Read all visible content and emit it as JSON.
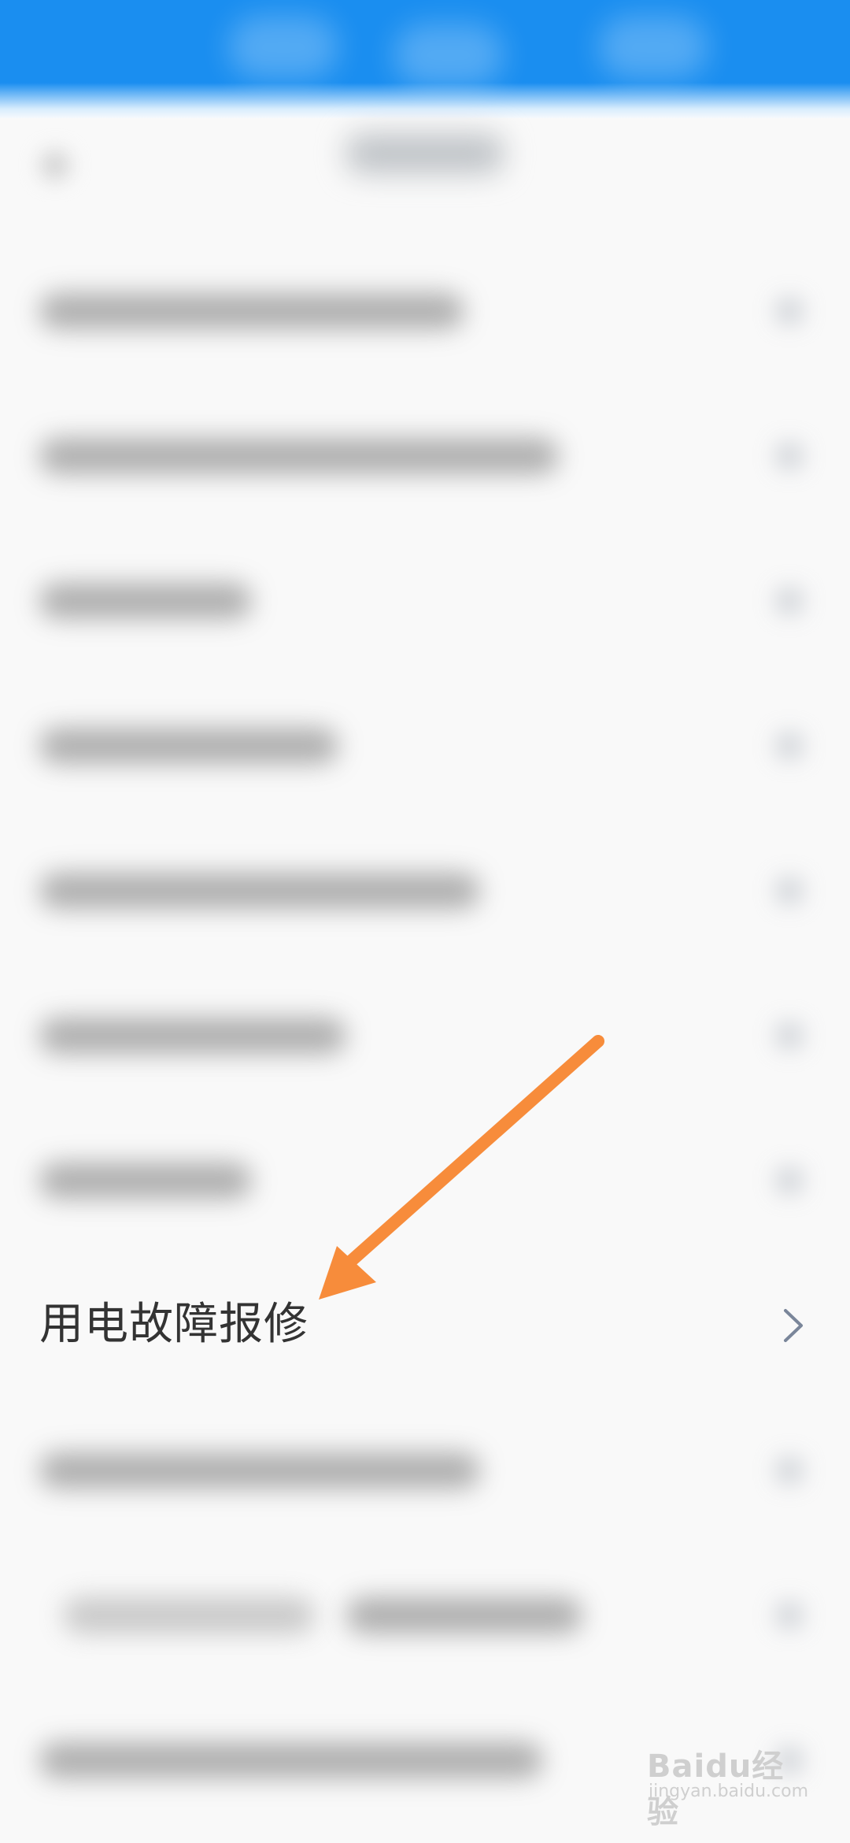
{
  "list": {
    "highlighted_item": {
      "label": "用电故障报修",
      "icon": "chevron-right-icon"
    }
  },
  "annotation": {
    "color": "#f78c3b",
    "icon": "arrow-annotation"
  },
  "watermark": {
    "brand": "Baidu经验",
    "site": "jingyan.baidu.com"
  },
  "colors": {
    "topbar": "#1a8ef0",
    "background": "#f9f9f9",
    "label_text": "#333333",
    "chevron": "#7a869a"
  }
}
